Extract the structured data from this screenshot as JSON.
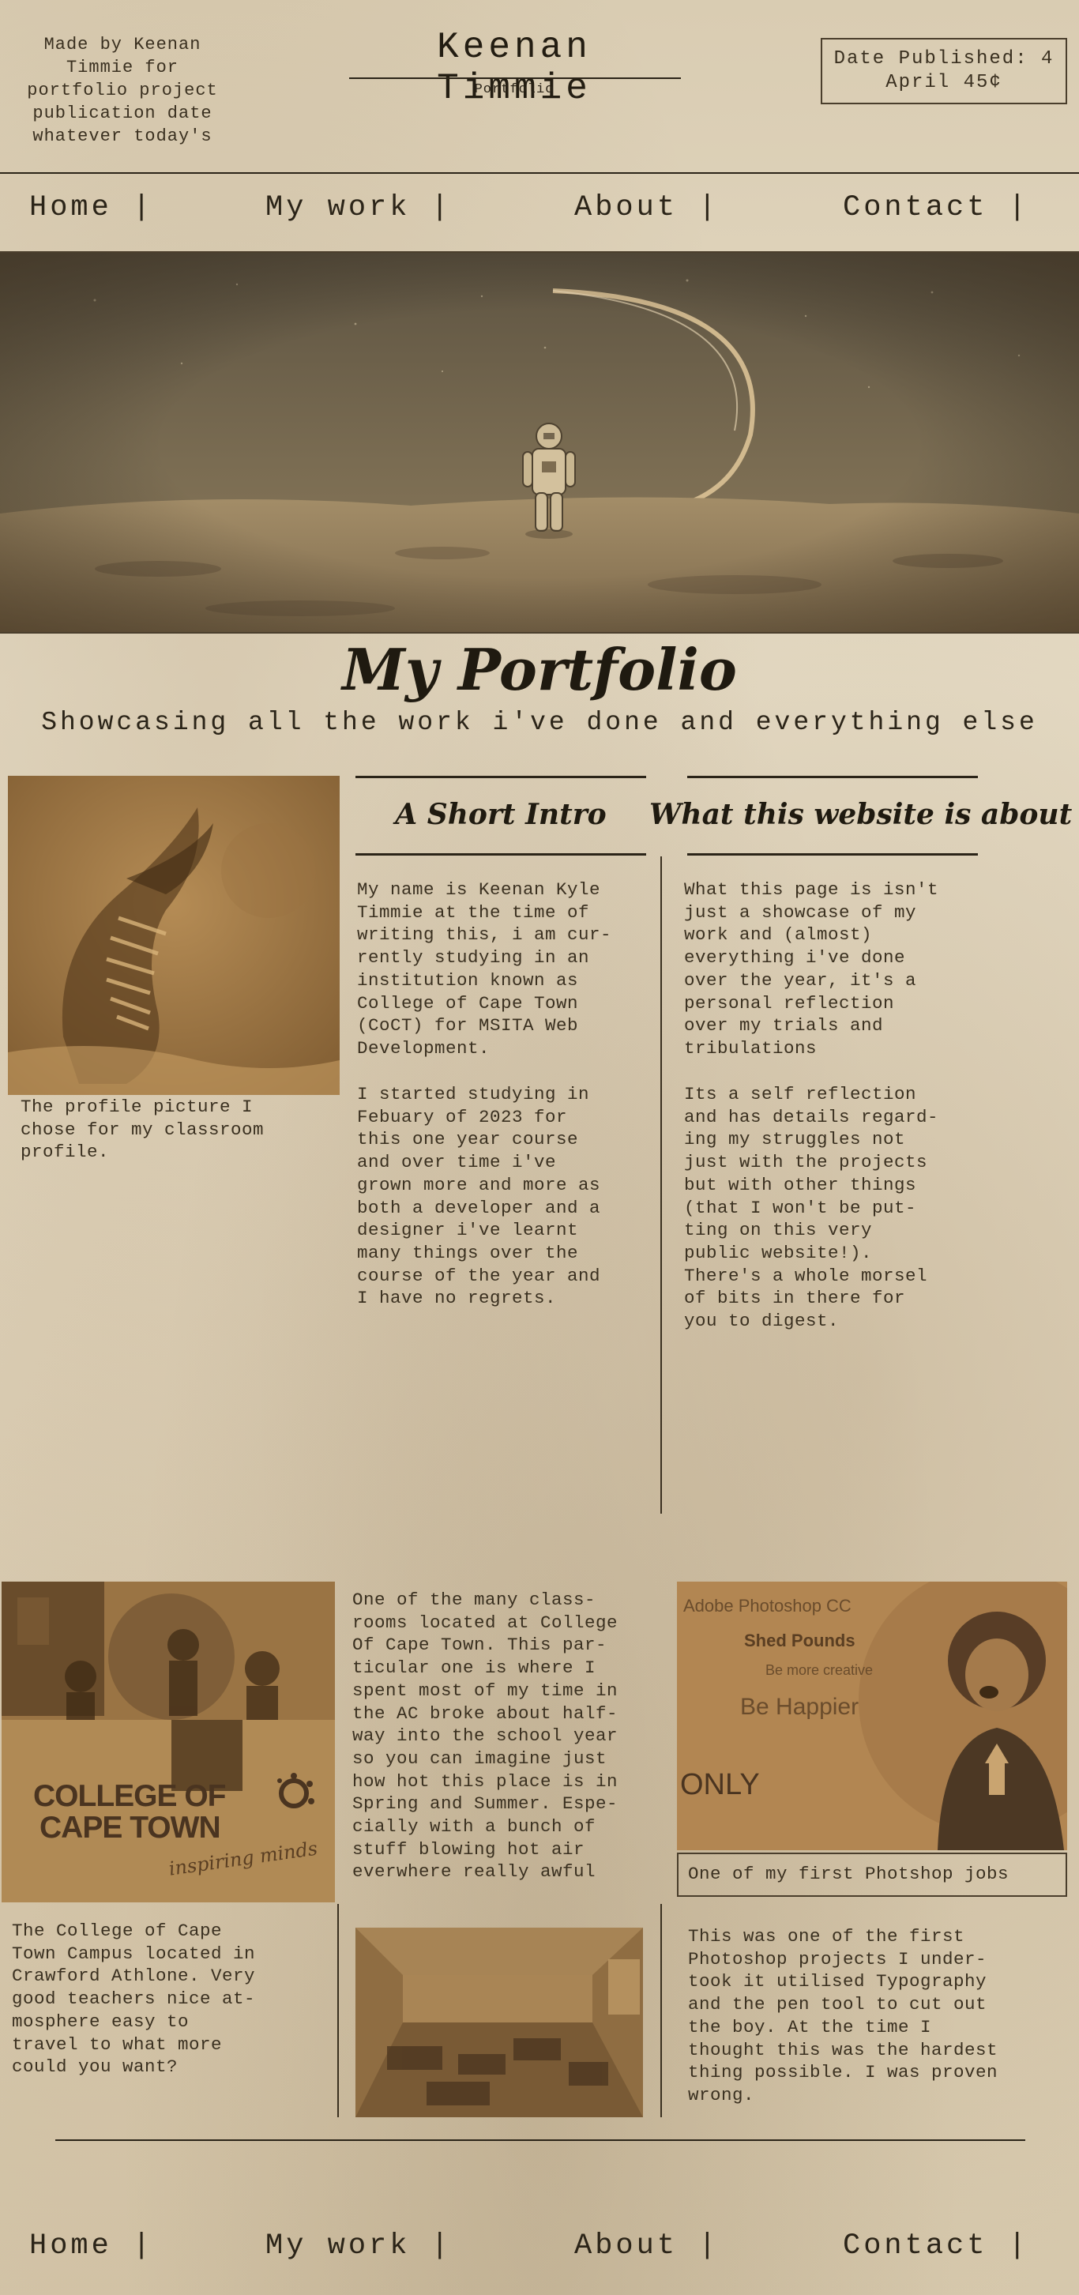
{
  "header": {
    "made_by": "Made by Keenan\nTimmie for\nportfolio project\npublication date\nwhatever today's",
    "title": "Keenan Timmie",
    "subtitle": "Portfolio",
    "date_published": "Date Published: 4\nApril 45¢"
  },
  "nav": {
    "home": "Home |",
    "work": "My work |",
    "about": "About |",
    "contact": "Contact |"
  },
  "main": {
    "heading": "My Portfolio",
    "subheading": "Showcasing all the work i've done and everything else"
  },
  "profile": {
    "caption": "The profile picture I\nchose for my classroom\nprofile."
  },
  "intro": {
    "heading": "A Short Intro",
    "paragraph1": "My name is Keenan Kyle\nTimmie at the time of\nwriting this, i am cur-\nrently studying in an\ninstitution known as\nCollege of Cape Town\n(CoCT) for MSITA Web\nDevelopment.",
    "paragraph2": "I started studying in\nFebuary of 2023 for\nthis one year course\nand over time i've\ngrown more and more as\nboth a developer and a\ndesigner i've learnt\nmany things over the\ncourse of the year and\nI have no regrets."
  },
  "about_site": {
    "heading": "What this website is about",
    "paragraph1": "What this page is isn't\njust a showcase of my\nwork and (almost)\neverything i've done\nover the year, it's a\npersonal reflection\nover my trials and\ntribulations",
    "paragraph2": "Its a self reflection\nand has details regard-\ning my struggles not\njust with the projects\nbut with other things\n(that I won't be put-\nting on this very\npublic website!).\nThere's a whole morsel\nof bits in there for\nyou to digest."
  },
  "college": {
    "logo_line1": "COLLEGE OF",
    "logo_line2": "CAPE TOWN",
    "logo_tagline": "inspiring minds",
    "caption": "The College of Cape\nTown Campus located in\nCrawford Athlone. Very\ngood teachers nice at-\nmosphere easy to\ntravel to what more\ncould you want?"
  },
  "classroom": {
    "text": "One of the many class-\nrooms located at College\nOf Cape Town. This par-\nticular one is where I\nspent most of my time in\nthe AC broke about half-\nway into the school year\nso you can imagine just\nhow hot this place is in\nSpring and Summer. Espe-\ncially with a bunch of\nstuff blowing hot air\neverwhere really awful"
  },
  "photoshop": {
    "poster_line1": "Adobe Photoshop CC",
    "poster_line2": "Shed Pounds",
    "poster_line3": "Be more creative",
    "poster_line4": "Be Happier",
    "poster_line5": "ONLY",
    "caption": "One of my first Photshop jobs",
    "description": "This was one of the first\nPhotoshop projects I under-\ntook it utilised Typography\nand the pen tool to cut out\nthe boy. At the time I\nthought this was the hardest\nthing possible. I was proven\nwrong."
  },
  "colors": {
    "paper": "#e2d7c0",
    "ink": "#2b2418",
    "sepia_photo": "#9a7444"
  }
}
